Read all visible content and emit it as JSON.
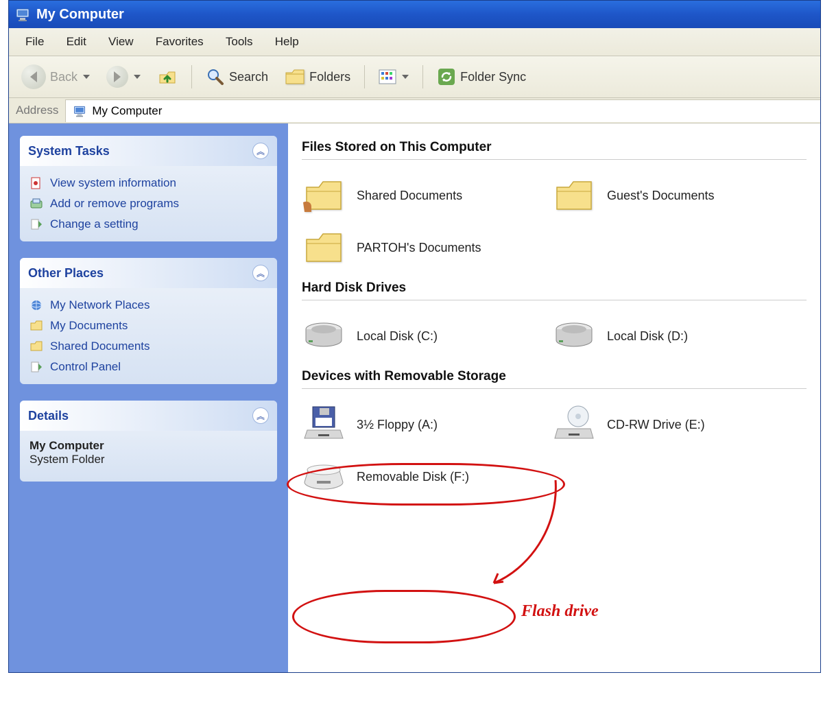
{
  "window": {
    "title": "My Computer"
  },
  "menu": {
    "file": "File",
    "edit": "Edit",
    "view": "View",
    "favorites": "Favorites",
    "tools": "Tools",
    "help": "Help"
  },
  "toolbar": {
    "back": "Back",
    "search": "Search",
    "folders": "Folders",
    "folder_sync": "Folder Sync"
  },
  "address": {
    "label": "Address",
    "value": "My Computer"
  },
  "sidebar": {
    "system_tasks": {
      "title": "System Tasks",
      "items": [
        {
          "label": "View system information"
        },
        {
          "label": "Add or remove programs"
        },
        {
          "label": "Change a setting"
        }
      ]
    },
    "other_places": {
      "title": "Other Places",
      "items": [
        {
          "label": "My Network Places"
        },
        {
          "label": "My Documents"
        },
        {
          "label": "Shared Documents"
        },
        {
          "label": "Control Panel"
        }
      ]
    },
    "details": {
      "title": "Details",
      "line1": "My Computer",
      "line2": "System Folder"
    }
  },
  "main": {
    "sections": {
      "files": {
        "title": "Files Stored on This Computer",
        "items": [
          {
            "label": "Shared Documents"
          },
          {
            "label": "Guest's Documents"
          },
          {
            "label": "PARTOH's Documents"
          }
        ]
      },
      "hdd": {
        "title": "Hard Disk Drives",
        "items": [
          {
            "label": "Local Disk (C:)"
          },
          {
            "label": "Local Disk (D:)"
          }
        ]
      },
      "removable": {
        "title": "Devices with Removable Storage",
        "items": [
          {
            "label": "3½ Floppy (A:)"
          },
          {
            "label": "CD-RW Drive (E:)"
          },
          {
            "label": "Removable Disk (F:)"
          }
        ]
      }
    }
  },
  "annotation": {
    "label": "Flash drive"
  }
}
